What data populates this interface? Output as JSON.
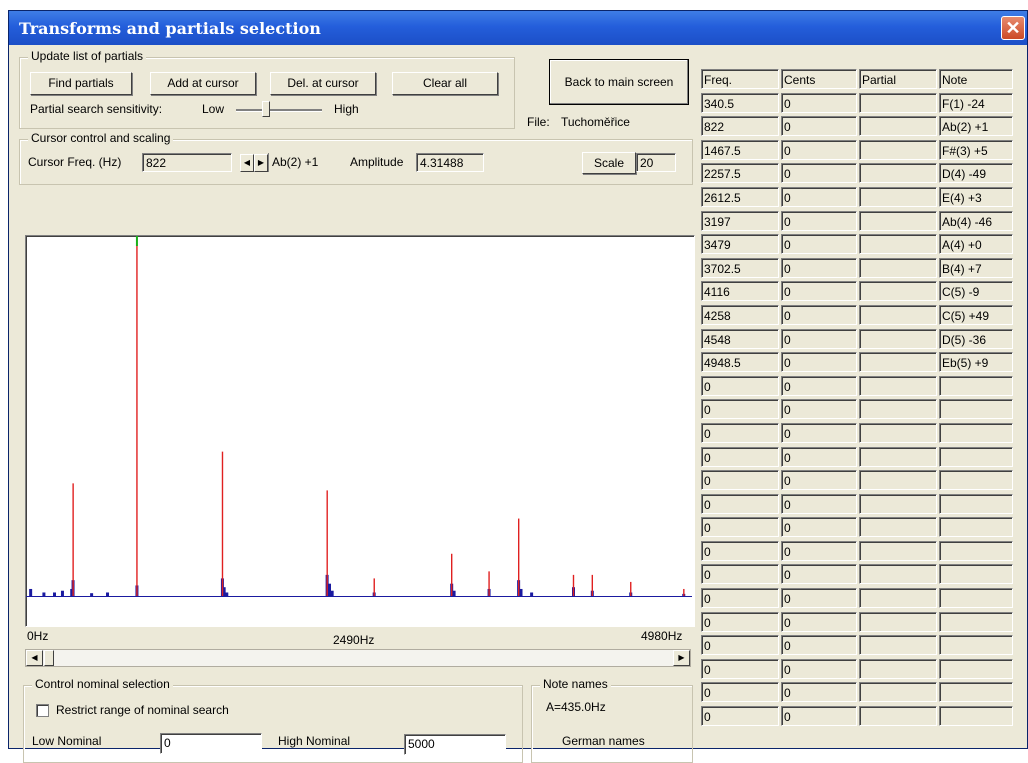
{
  "window": {
    "title": "Transforms and partials selection",
    "close_label": "✕"
  },
  "update_group": {
    "label": "Update list of partials",
    "buttons": [
      "Find partials",
      "Add at cursor",
      "Del. at cursor",
      "Clear all"
    ],
    "sensitivity_label": "Partial search sensitivity:",
    "low": "Low",
    "high": "High",
    "sensitivity_level": 0.35
  },
  "back_button": "Back to main screen",
  "file": {
    "label": "File:",
    "name": "Tuchoměřice"
  },
  "cursor_group": {
    "label": "Cursor control and scaling",
    "freq_label": "Cursor Freq. (Hz)",
    "freq_value": "822",
    "note": "Ab(2) +1",
    "amplitude_label": "Amplitude",
    "amplitude_value": "4.31488",
    "scale_label": "Scale",
    "scale_value": "20"
  },
  "chart_data": {
    "type": "bar",
    "x_unit": "Hz",
    "xlim": [
      0,
      4980
    ],
    "tick_labels": [
      "0Hz",
      "2490Hz",
      "4980Hz"
    ],
    "colors": {
      "partial": "#e02020",
      "spectrum": "#1a1aa0",
      "cursor": "#18b018"
    },
    "cursor_freq": 822,
    "partials": [
      {
        "freq": 340.5,
        "amplitude": 0.32
      },
      {
        "freq": 822,
        "amplitude": 1.0
      },
      {
        "freq": 1467.5,
        "amplitude": 0.41
      },
      {
        "freq": 2257.5,
        "amplitude": 0.3
      },
      {
        "freq": 2612.5,
        "amplitude": 0.05
      },
      {
        "freq": 3197,
        "amplitude": 0.12
      },
      {
        "freq": 3479,
        "amplitude": 0.07
      },
      {
        "freq": 3702.5,
        "amplitude": 0.22
      },
      {
        "freq": 4116,
        "amplitude": 0.06
      },
      {
        "freq": 4258,
        "amplitude": 0.06
      },
      {
        "freq": 4548,
        "amplitude": 0.04
      },
      {
        "freq": 4948.5,
        "amplitude": 0.02
      }
    ],
    "spectrum": [
      {
        "freq": 20,
        "amplitude": 0.02
      },
      {
        "freq": 120,
        "amplitude": 0.01
      },
      {
        "freq": 200,
        "amplitude": 0.01
      },
      {
        "freq": 260,
        "amplitude": 0.015
      },
      {
        "freq": 340,
        "amplitude": 0.045
      },
      {
        "freq": 330,
        "amplitude": 0.02
      },
      {
        "freq": 480,
        "amplitude": 0.008
      },
      {
        "freq": 600,
        "amplitude": 0.01
      },
      {
        "freq": 822,
        "amplitude": 0.03
      },
      {
        "freq": 1467,
        "amplitude": 0.05
      },
      {
        "freq": 1480,
        "amplitude": 0.025
      },
      {
        "freq": 1500,
        "amplitude": 0.01
      },
      {
        "freq": 2257,
        "amplitude": 0.06
      },
      {
        "freq": 2275,
        "amplitude": 0.035
      },
      {
        "freq": 2295,
        "amplitude": 0.015
      },
      {
        "freq": 2612,
        "amplitude": 0.01
      },
      {
        "freq": 3197,
        "amplitude": 0.035
      },
      {
        "freq": 3215,
        "amplitude": 0.015
      },
      {
        "freq": 3479,
        "amplitude": 0.02
      },
      {
        "freq": 3702,
        "amplitude": 0.045
      },
      {
        "freq": 3720,
        "amplitude": 0.02
      },
      {
        "freq": 3800,
        "amplitude": 0.01
      },
      {
        "freq": 4116,
        "amplitude": 0.025
      },
      {
        "freq": 4258,
        "amplitude": 0.015
      },
      {
        "freq": 4548,
        "amplitude": 0.01
      },
      {
        "freq": 4948,
        "amplitude": 0.006
      }
    ]
  },
  "axis": {
    "left": "0Hz",
    "mid": "2490Hz",
    "right": "4980Hz"
  },
  "nominal_group": {
    "label": "Control nominal selection",
    "checkbox_label": "Restrict range of nominal search",
    "low_label": "Low Nominal",
    "low_value": "0",
    "high_label": "High Nominal",
    "high_value": "5000"
  },
  "note_names_group": {
    "label": "Note names",
    "reference": "A=435.0Hz",
    "naming": "German names"
  },
  "partials_table": {
    "headers": [
      "Freq.",
      "Cents",
      "Partial",
      "Note"
    ],
    "rows": [
      [
        "340.5",
        "0",
        "",
        "F(1) -24"
      ],
      [
        "822",
        "0",
        "",
        "Ab(2) +1"
      ],
      [
        "1467.5",
        "0",
        "",
        "F#(3) +5"
      ],
      [
        "2257.5",
        "0",
        "",
        "D(4) -49"
      ],
      [
        "2612.5",
        "0",
        "",
        "E(4) +3"
      ],
      [
        "3197",
        "0",
        "",
        "Ab(4) -46"
      ],
      [
        "3479",
        "0",
        "",
        "A(4) +0"
      ],
      [
        "3702.5",
        "0",
        "",
        "B(4) +7"
      ],
      [
        "4116",
        "0",
        "",
        "C(5) -9"
      ],
      [
        "4258",
        "0",
        "",
        "C(5) +49"
      ],
      [
        "4548",
        "0",
        "",
        "D(5) -36"
      ],
      [
        "4948.5",
        "0",
        "",
        "Eb(5) +9"
      ],
      [
        "0",
        "0",
        "",
        ""
      ],
      [
        "0",
        "0",
        "",
        ""
      ],
      [
        "0",
        "0",
        "",
        ""
      ],
      [
        "0",
        "0",
        "",
        ""
      ],
      [
        "0",
        "0",
        "",
        ""
      ],
      [
        "0",
        "0",
        "",
        ""
      ],
      [
        "0",
        "0",
        "",
        ""
      ],
      [
        "0",
        "0",
        "",
        ""
      ],
      [
        "0",
        "0",
        "",
        ""
      ],
      [
        "0",
        "0",
        "",
        ""
      ],
      [
        "0",
        "0",
        "",
        ""
      ],
      [
        "0",
        "0",
        "",
        ""
      ],
      [
        "0",
        "0",
        "",
        ""
      ],
      [
        "0",
        "0",
        "",
        ""
      ],
      [
        "0",
        "0",
        "",
        ""
      ]
    ]
  }
}
